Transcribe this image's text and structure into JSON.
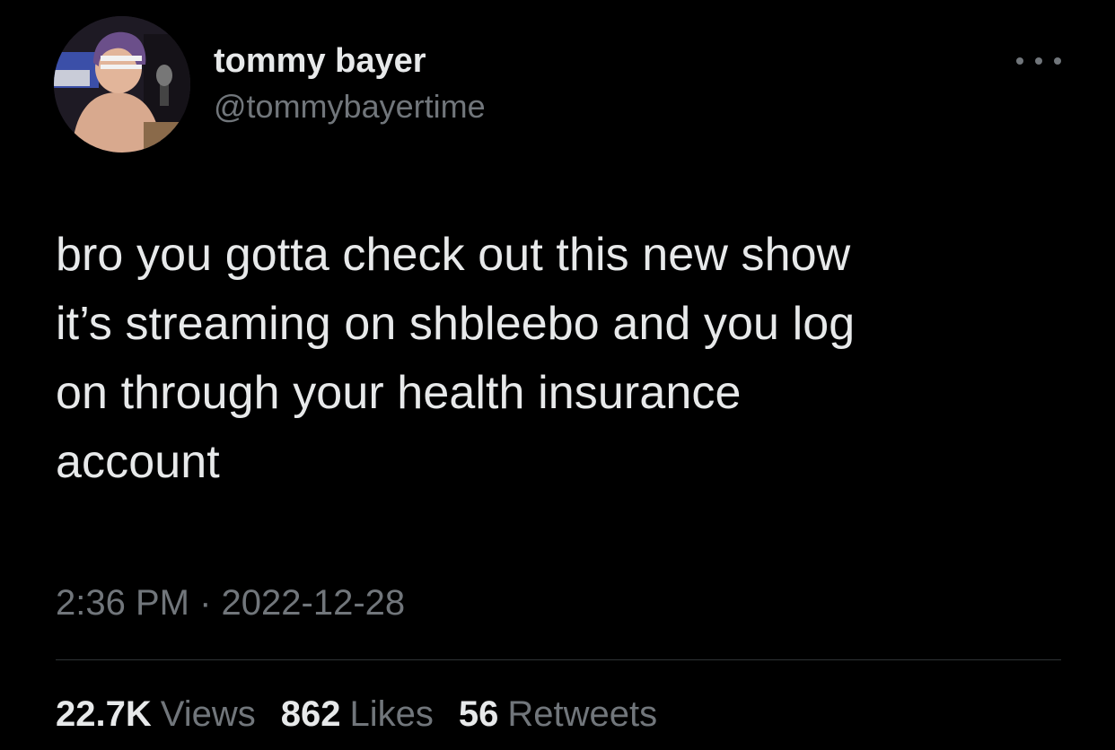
{
  "tweet": {
    "author": {
      "display_name": "tommy bayer",
      "handle": "@tommybayertime"
    },
    "text": "bro you gotta check out this new show\nit’s streaming on shbleebo and you log\non through your health insurance\naccount",
    "time": "2:36 PM",
    "separator": "·",
    "date": "2022-12-28",
    "stats": [
      {
        "value": "22.7K",
        "label": "Views"
      },
      {
        "value": "862",
        "label": "Likes"
      },
      {
        "value": "56",
        "label": "Retweets"
      }
    ],
    "icons": {
      "more": "more-horizontal-icon"
    }
  },
  "colors": {
    "background": "#000000",
    "primary_text": "#e7e9ea",
    "secondary_text": "#71767b",
    "divider": "#2f3336"
  }
}
